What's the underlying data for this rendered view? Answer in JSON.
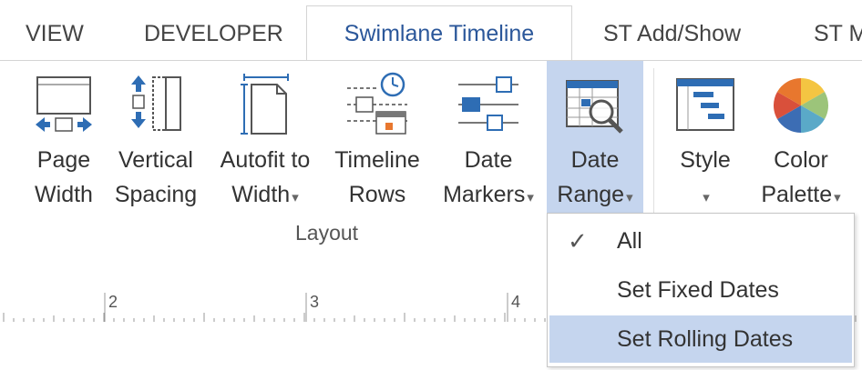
{
  "tabs": [
    {
      "label": "VIEW"
    },
    {
      "label": "DEVELOPER"
    },
    {
      "label": "Swimlane Timeline",
      "active": true
    },
    {
      "label": "ST Add/Show"
    },
    {
      "label": "ST M"
    }
  ],
  "ribbon": {
    "buttons": [
      {
        "line1": "Page",
        "line2": "Width",
        "icon": "page-width-icon"
      },
      {
        "line1": "Vertical",
        "line2": "Spacing",
        "icon": "vertical-spacing-icon"
      },
      {
        "line1": "Autofit to",
        "line2": "Width",
        "icon": "autofit-icon",
        "has_dropdown": true
      },
      {
        "line1": "Timeline",
        "line2": "Rows",
        "icon": "timeline-rows-icon"
      },
      {
        "line1": "Date",
        "line2": "Markers",
        "icon": "date-markers-icon",
        "has_dropdown": true
      },
      {
        "line1": "Date",
        "line2": "Range",
        "icon": "date-range-icon",
        "has_dropdown": true,
        "selected": true
      },
      {
        "line1": "Style",
        "line2": "",
        "icon": "style-icon",
        "has_dropdown": true
      },
      {
        "line1": "Color",
        "line2": "Palette",
        "icon": "color-palette-icon",
        "has_dropdown": true
      }
    ],
    "group_label": "Layout",
    "caret": "▾"
  },
  "ruler": {
    "labels": [
      "2",
      "3",
      "4"
    ]
  },
  "dropdown": {
    "items": [
      {
        "label": "All",
        "checked": true,
        "check_glyph": "✓"
      },
      {
        "label": "Set Fixed Dates",
        "checked": false
      },
      {
        "label": "Set Rolling Dates",
        "checked": false,
        "hovered": true
      }
    ]
  },
  "colors": {
    "accent": "#2b579a",
    "selected_bg": "#c5d5ee",
    "icon_blue": "#2e6db4",
    "icon_orange": "#e8772e"
  }
}
